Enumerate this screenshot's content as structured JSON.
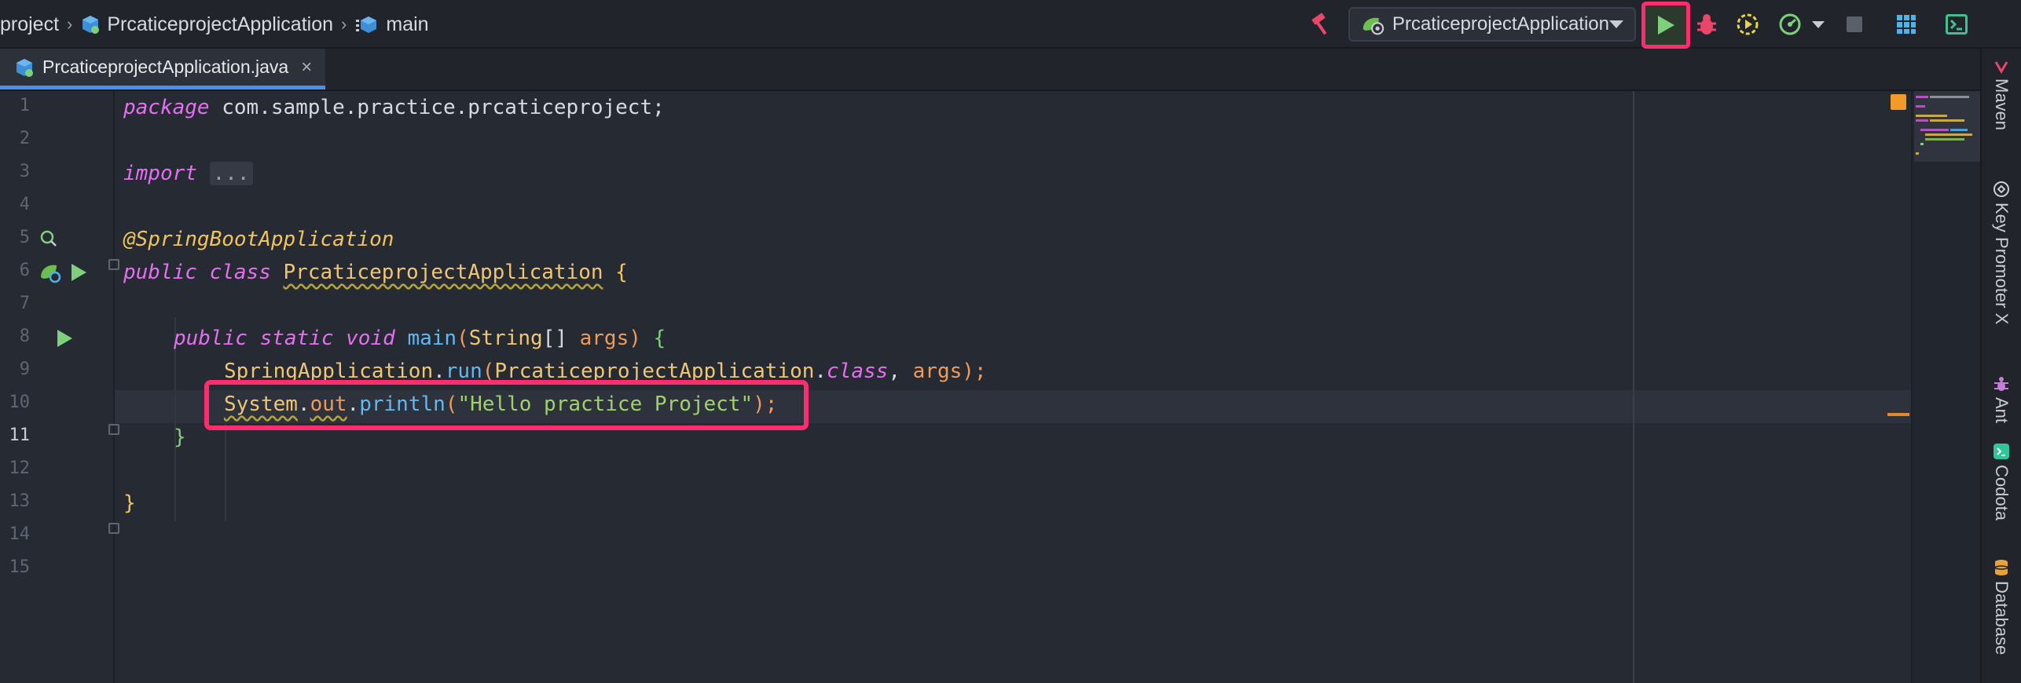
{
  "breadcrumb": [
    "project",
    "PrcaticeprojectApplication",
    "main"
  ],
  "breadcrumb_separator": "›",
  "run_config": {
    "name": "PrcaticeprojectApplication"
  },
  "toolbar_icons": [
    "build-hammer-icon",
    "run-icon",
    "debug-icon",
    "run-with-coverage-icon",
    "profiler-icon",
    "profiler-dropdown-icon",
    "stop-icon",
    "project-structure-icon",
    "terminal-icon"
  ],
  "tab": {
    "label": "PrcaticeprojectApplication.java",
    "close": "×"
  },
  "editor": {
    "line_numbers": [
      "1",
      "2",
      "3",
      "4",
      "5",
      "6",
      "7",
      "8",
      "9",
      "10",
      "11",
      "12",
      "13",
      "14",
      "15"
    ],
    "current_line": "11",
    "code": {
      "l1_kw": "package",
      "l1_rest": " com.sample.practice.prcaticeproject;",
      "l3_kw": "import",
      "l3_fold": "...",
      "l6_ann": "@SpringBootApplication",
      "l7_kw1": "public",
      "l7_kw2": "class",
      "l7_cls": "PrcaticeprojectApplication",
      "l7_brace": "{",
      "l9_kw1": "public",
      "l9_kw2": "static",
      "l9_kw3": "void",
      "l9_fn": "main",
      "l9_type": "String",
      "l9_arr": "[] ",
      "l9_param": "args",
      "l9_close": ") ",
      "l9_brace": "{",
      "l10_cls": "SpringApplication",
      "l10_fn": "run",
      "l10_arg_cls": "PrcaticeprojectApplication",
      "l10_kw": "class",
      "l10_sep": ", ",
      "l10_param": "args",
      "l10_end": ");",
      "l11_cls": "System",
      "l11_field": "out",
      "l11_fn": "println",
      "l11_str": "\"Hello practice Project\"",
      "l11_end": ");",
      "l12_brace": "}",
      "l14_brace": "}"
    }
  },
  "right_tools": [
    {
      "label": "Maven",
      "icon": "maven-icon"
    },
    {
      "label": "Key Promoter X",
      "icon": "key-promoter-icon"
    },
    {
      "label": "Ant",
      "icon": "ant-icon"
    },
    {
      "label": "Codota",
      "icon": "codota-icon"
    },
    {
      "label": "Database",
      "icon": "database-icon"
    }
  ],
  "colors": {
    "highlight": "#ff2d6e",
    "run_green": "#7fd07d",
    "debug_red": "#e8466b",
    "keyword": "#e56ff0",
    "string": "#9fd26b",
    "annotation": "#f2c55c",
    "function": "#5fb9f5"
  }
}
